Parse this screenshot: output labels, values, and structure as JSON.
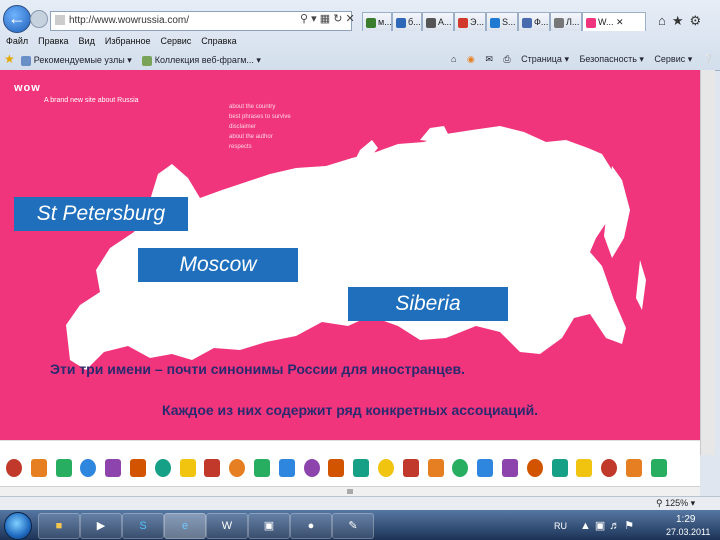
{
  "browser": {
    "url": "http://www.wowrussia.com/",
    "tabs": [
      {
        "label": "м...",
        "color": "#3a7d2c"
      },
      {
        "label": "б...",
        "color": "#2e66b8"
      },
      {
        "label": "А...",
        "color": "#555555"
      },
      {
        "label": "Э...",
        "color": "#d0392b"
      },
      {
        "label": "S...",
        "color": "#1f7bd1"
      },
      {
        "label": "Ф...",
        "color": "#4a6ab0"
      },
      {
        "label": "Л...",
        "color": "#777777"
      },
      {
        "label": "W...",
        "color": "#f0357c",
        "active": true
      }
    ],
    "menu": [
      "Файл",
      "Правка",
      "Вид",
      "Избранное",
      "Сервис",
      "Справка"
    ],
    "favorites": [
      "Рекомендуемые узлы",
      "Коллекция веб-фрагм..."
    ],
    "commands": [
      "Страница",
      "Безопасность",
      "Сервис"
    ],
    "zoom": "125%"
  },
  "site": {
    "logo": "wow",
    "tagline": "A brand new site about Russia",
    "nav": [
      "about the country",
      "best phrases to survive",
      "disclaimer",
      "about the author",
      "respects"
    ],
    "cities": [
      "St Petersburg",
      "Moscow",
      "Siberia"
    ],
    "caption1": "Эти три имени – почти синонимы России для иностранцев.",
    "caption2": "Каждое из них содержит ряд конкретных ассоциаций.",
    "map_color": "#ffffff",
    "bg_color": "#f0357c",
    "accent_color": "#1f6fbd",
    "icon_row": [
      "eagle-icon",
      "matryoshka-icon",
      "accordion-icon",
      "fountain-icon",
      "bucket-icon",
      "church-icon",
      "samovar-icon",
      "diamond-icon",
      "vodka-icon",
      "hockey-icon",
      "doll-icon",
      "valenki-icon",
      "ship-icon",
      "boat-icon",
      "rocket-icon",
      "tree-icon",
      "rifle-icon",
      "cheburashka-icon",
      "boots-icon",
      "sickle-icon",
      "sun-icon",
      "clock-icon",
      "boot-icon",
      "bear-icon",
      "samovar2-icon",
      "star-icon",
      "bear2-icon"
    ]
  },
  "taskbar": {
    "lang": "RU",
    "time": "1:29",
    "date": "27.03.2011",
    "apps": [
      "folder",
      "media",
      "skype",
      "ie",
      "word",
      "save",
      "messenger",
      "paint"
    ]
  }
}
